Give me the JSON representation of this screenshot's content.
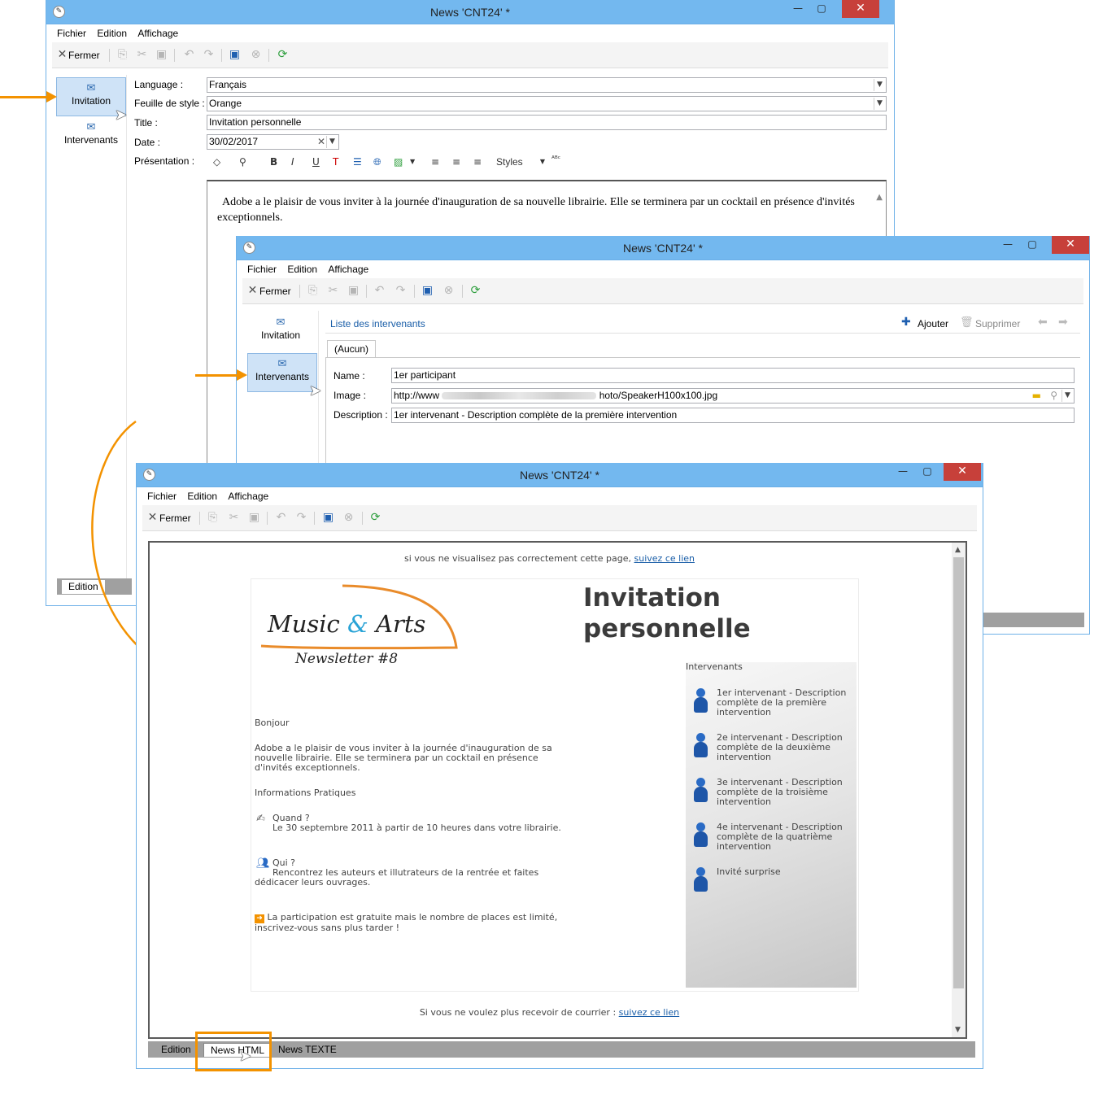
{
  "windows": [
    {
      "title": "News 'CNT24' *",
      "menu": [
        "Fichier",
        "Edition",
        "Affichage"
      ],
      "close_label": "Fermer",
      "nav": [
        "Invitation",
        "Intervenants"
      ],
      "form": {
        "language_label": "Language :",
        "language_value": "Français",
        "stylesheet_label": "Feuille de style :",
        "stylesheet_value": "Orange",
        "title_label": "Title :",
        "title_value": "Invitation personnelle",
        "date_label": "Date :",
        "date_value": "30/02/2017",
        "presentation_label": "Présentation :",
        "styles_label": "Styles",
        "editor_text": "Adobe  a le plaisir de vous inviter à la journée d'inauguration de sa nouvelle librairie. Elle se terminera par un cocktail en présence d'invités exceptionnels."
      },
      "bottom_tab": "Edition"
    },
    {
      "title": "News 'CNT24' *",
      "menu": [
        "Fichier",
        "Edition",
        "Affichage"
      ],
      "close_label": "Fermer",
      "nav": [
        "Invitation",
        "Intervenants"
      ],
      "list_title": "Liste des intervenants",
      "add_label": "Ajouter",
      "delete_label": "Supprimer",
      "tab_label": "(Aucun)",
      "name_label": "Name :",
      "name_value": "1er participant",
      "image_label": "Image :",
      "image_value_start": "http://www",
      "image_value_end": "hoto/SpeakerH100x100.jpg",
      "description_label": "Description :",
      "description_value": "1er intervenant - Description complète de la première intervention"
    },
    {
      "title": "News 'CNT24' *",
      "menu": [
        "Fichier",
        "Edition",
        "Affichage"
      ],
      "close_label": "Fermer",
      "bottom_tabs": [
        "Edition",
        "News HTML",
        "News TEXTE"
      ]
    }
  ],
  "newsletter": {
    "top_notice": "si vous ne visualisez pas correctement cette page,",
    "top_link": "suivez ce lien",
    "logo_main_a": "Music",
    "logo_amp": "&",
    "logo_main_b": "Arts",
    "logo_sub": "Newsletter #8",
    "heading_line1": "Invitation",
    "heading_line2": "personnelle",
    "greeting": "Bonjour",
    "intro": "Adobe a le plaisir de vous inviter à la journée d'inauguration de sa nouvelle librairie. Elle se terminera par un cocktail en présence d'invités exceptionnels.",
    "info_heading": "Informations Pratiques",
    "when_label": "Quand ?",
    "when_text": "Le 30 septembre 2011 à partir de 10 heures dans votre librairie.",
    "who_label": "Qui ?",
    "who_text": "Rencontrez les auteurs et illutrateurs de la rentrée et faites dédicacer leurs ouvrages.",
    "free_text": "La participation est gratuite mais le nombre de places est limité, inscrivez-vous sans plus tarder !",
    "sidebar_title": "Intervenants",
    "speakers": [
      "1er intervenant - Description complète de la première intervention",
      "2e intervenant - Description complète de la deuxième intervention",
      "3e intervenant - Description complète de la troisième intervention",
      "4e intervenant - Description complète de la quatrième intervention",
      "Invité surprise"
    ],
    "bottom_notice": "Si vous ne voulez plus recevoir de courrier :",
    "bottom_link": "suivez ce lien"
  },
  "colors": {
    "titlebar": "#73b8ef",
    "accent_arrow": "#f39200",
    "close_button": "#c7403a",
    "link": "#1a5ea8"
  }
}
